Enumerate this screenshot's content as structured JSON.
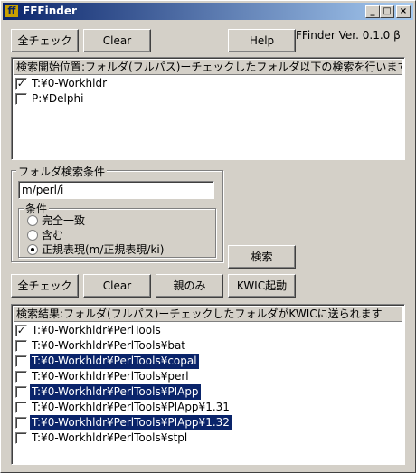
{
  "window": {
    "title": "FFFinder",
    "icon": "app-logo-icon"
  },
  "titlebar_buttons": {
    "minimize": "_",
    "maximize": "□",
    "close": "×"
  },
  "toolbar": {
    "check_all": "全チェック",
    "clear": "Clear",
    "help": "Help",
    "version": "FFinder Ver. 0.1.0 β"
  },
  "start_list": {
    "header": "検索開始位置:フォルダ(フルパス)ーチェックしたフォルダ以下の検索を行います",
    "items": [
      {
        "label": "T:¥0-Workhldr",
        "checked": true
      },
      {
        "label": "P:¥Delphi",
        "checked": false
      }
    ]
  },
  "condition": {
    "group_title": "フォルダ検索条件",
    "pattern": "m/perl/i",
    "sub_title": "条件",
    "options": [
      {
        "label": "完全一致",
        "selected": false
      },
      {
        "label": "含む",
        "selected": false
      },
      {
        "label": "正規表現(m/正規表現/ki)",
        "selected": true
      }
    ],
    "search_button": "検索"
  },
  "result_toolbar": {
    "check_all": "全チェック",
    "clear": "Clear",
    "parent_only": "親のみ",
    "kwic": "KWIC起動"
  },
  "result_list": {
    "header": "検索結果:フォルダ(フルパス)ーチェックしたフォルダがKWICに送られます",
    "items": [
      {
        "label": "T:¥0-Workhldr¥PerlTools",
        "checked": true,
        "selected": false
      },
      {
        "label": "T:¥0-Workhldr¥PerlTools¥bat",
        "checked": false,
        "selected": false
      },
      {
        "label": "T:¥0-Workhldr¥PerlTools¥copal",
        "checked": false,
        "selected": true
      },
      {
        "label": "T:¥0-Workhldr¥PerlTools¥perl",
        "checked": false,
        "selected": false
      },
      {
        "label": "T:¥0-Workhldr¥PerlTools¥PIApp",
        "checked": false,
        "selected": true
      },
      {
        "label": "T:¥0-Workhldr¥PerlTools¥PIApp¥1.31",
        "checked": false,
        "selected": false
      },
      {
        "label": "T:¥0-Workhldr¥PerlTools¥PIApp¥1.32",
        "checked": false,
        "selected": true
      },
      {
        "label": "T:¥0-Workhldr¥PerlTools¥stpl",
        "checked": false,
        "selected": false
      }
    ]
  },
  "check_mark": "✓"
}
